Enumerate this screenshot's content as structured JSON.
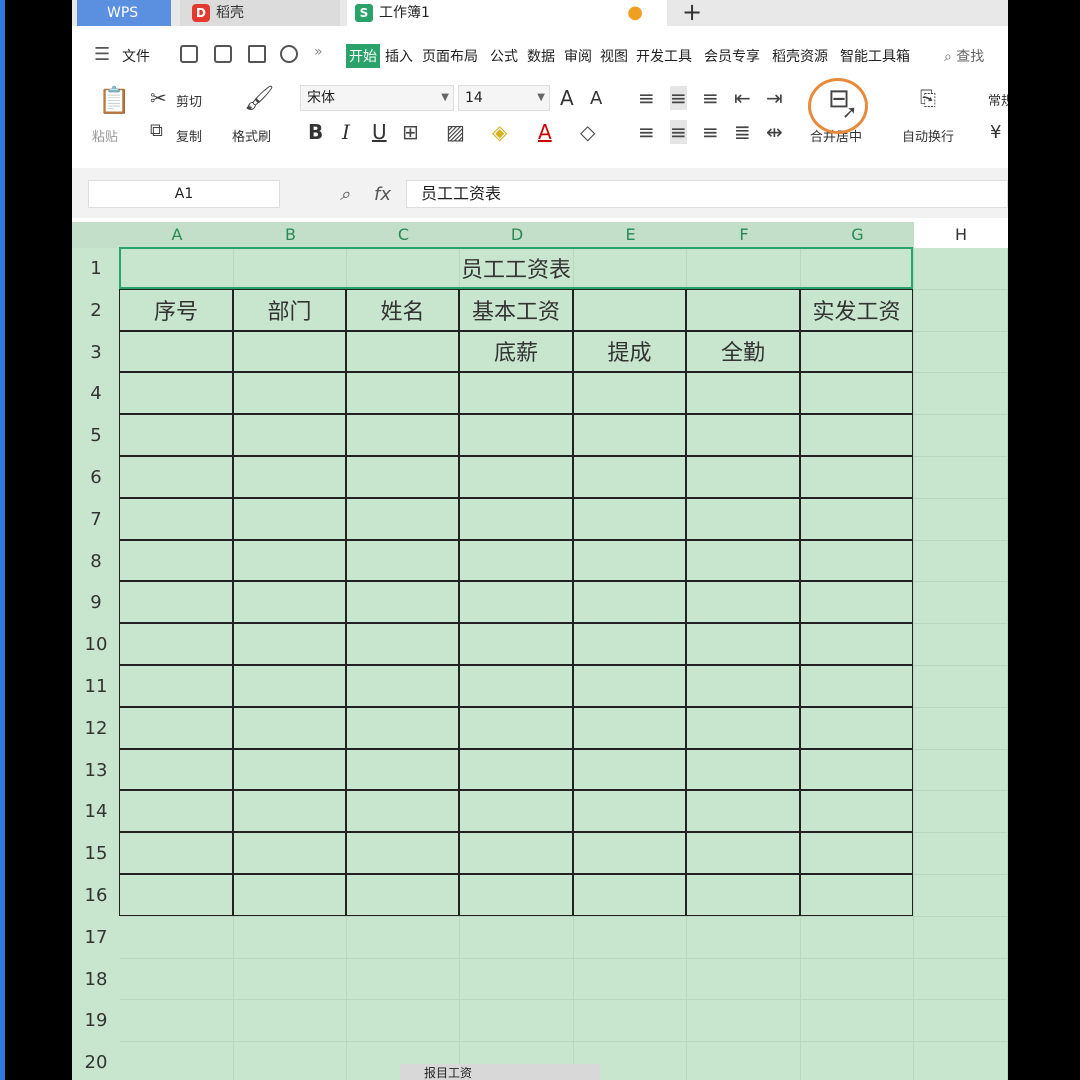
{
  "tabs": {
    "wps": "WPS",
    "daoke": "稻壳",
    "daoke_logo": "D",
    "workbook": "工作簿1",
    "workbook_logo": "S",
    "modified_dot": "●",
    "add": "+"
  },
  "menu": {
    "file": "文件",
    "more": "»",
    "items": [
      "开始",
      "插入",
      "页面布局",
      "公式",
      "数据",
      "审阅",
      "视图",
      "开发工具",
      "会员专享",
      "稻壳资源",
      "智能工具箱"
    ],
    "active": "开始",
    "search": "查找"
  },
  "ribbon": {
    "paste": "粘贴",
    "cut": "剪切",
    "copy": "复制",
    "format_painter": "格式刷",
    "font_name": "宋体",
    "font_size": "14",
    "bold": "B",
    "italic": "I",
    "underline": "U",
    "merge_center": "合并居中",
    "wrap_text": "自动换行",
    "grow_font": "A",
    "shrink_font": "A",
    "font_color": "A",
    "number_format": "常规",
    "currency": "¥"
  },
  "formula_bar": {
    "name_box": "A1",
    "fx": "fx",
    "content": "员工工资表"
  },
  "grid": {
    "columns": [
      "A",
      "B",
      "C",
      "D",
      "E",
      "F",
      "G",
      "H"
    ],
    "rows": [
      "1",
      "2",
      "3",
      "4",
      "5",
      "6",
      "7",
      "8",
      "9",
      "10",
      "11",
      "12",
      "13",
      "14",
      "15",
      "16",
      "17",
      "18",
      "19",
      "20"
    ],
    "title": "员工工资表",
    "row2": [
      "序号",
      "部门",
      "姓名",
      "基本工资",
      "",
      "",
      "实发工资"
    ],
    "row3": [
      "",
      "",
      "",
      "底薪",
      "提成",
      "全勤",
      ""
    ]
  },
  "status": {
    "sheet_tab": "报目工资"
  },
  "colors": {
    "accent": "#2aa36b",
    "sheet_bg": "#c8e6ce",
    "wps_tab": "#5b8fe0",
    "highlight_ring": "#e98a3a"
  }
}
